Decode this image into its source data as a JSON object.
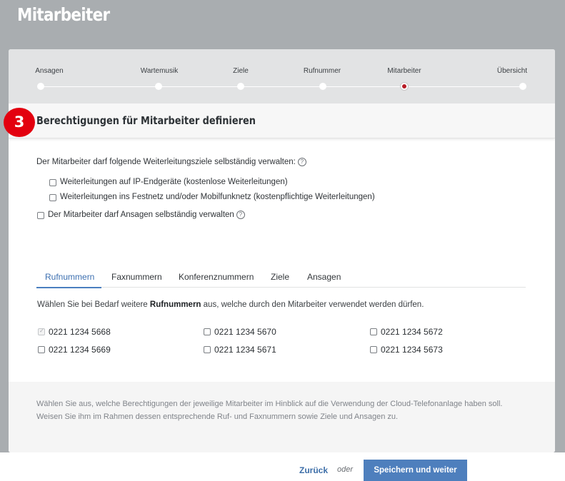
{
  "page": {
    "title": "Mitarbeiter"
  },
  "stepper": {
    "steps": [
      {
        "label": "Ansagen",
        "active": false
      },
      {
        "label": "Wartemusik",
        "active": false
      },
      {
        "label": "Ziele",
        "active": false
      },
      {
        "label": "Rufnummer",
        "active": false
      },
      {
        "label": "Mitarbeiter",
        "active": true
      },
      {
        "label": "Übersicht",
        "active": false
      }
    ]
  },
  "section": {
    "step_number": "3",
    "title": "Berechtigungen für Mitarbeiter definieren"
  },
  "permissions": {
    "forward_intro": "Der Mitarbeiter darf folgende Weiterleitungsziele selbständig verwalten:",
    "help_glyph": "?",
    "options": [
      {
        "label": "Weiterleitungen auf IP-Endgeräte (kostenlose Weiterleitungen)",
        "checked": false
      },
      {
        "label": "Weiterleitungen ins Festnetz und/oder Mobilfunknetz (kostenpflichtige Weiterleitungen)",
        "checked": false
      }
    ],
    "announcements": {
      "label": "Der Mitarbeiter darf Ansagen selbständig verwalten",
      "checked": false
    }
  },
  "tabs": [
    {
      "label": "Rufnummern",
      "active": true
    },
    {
      "label": "Faxnummern",
      "active": false
    },
    {
      "label": "Konferenznummern",
      "active": false
    },
    {
      "label": "Ziele",
      "active": false
    },
    {
      "label": "Ansagen",
      "active": false
    }
  ],
  "numbers_section": {
    "info_before": "Wählen Sie bei Bedarf weitere ",
    "info_bold": "Rufnummern",
    "info_after": " aus, welche durch den Mitarbeiter verwendet werden dürfen.",
    "numbers": [
      {
        "label": "0221 1234 5668",
        "checked": true
      },
      {
        "label": "0221 1234 5670",
        "checked": false
      },
      {
        "label": "0221 1234 5672",
        "checked": false
      },
      {
        "label": "0221 1234 5669",
        "checked": false
      },
      {
        "label": "0221 1234 5671",
        "checked": false
      },
      {
        "label": "0221 1234 5673",
        "checked": false
      }
    ]
  },
  "footer_note": {
    "line1": "Wählen Sie aus, welche Berechtigungen der jeweilige Mitarbeiter im Hinblick auf die Verwendung der Cloud-Telefonanlage haben soll.",
    "line2": "Weisen Sie ihm im Rahmen dessen entsprechende Ruf- und Faxnummern sowie Ziele und Ansagen zu."
  },
  "actions": {
    "back_label": "Zurück",
    "or_label": "oder",
    "save_label": "Speichern und weiter"
  },
  "colors": {
    "accent": "#4e7fbd",
    "badge_red": "#e3000f",
    "active_step": "#b71c25"
  }
}
